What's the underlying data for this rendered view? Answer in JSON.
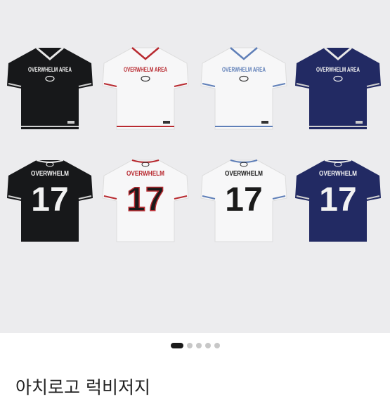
{
  "listing": {
    "title": "아치로고 럭비저지"
  },
  "gallery": {
    "image_count": 5,
    "active_index": 0
  },
  "jerseys": {
    "front_wordmark": "OVERWHELM AREA",
    "back_name": "OVERWHELM",
    "back_number": "17",
    "badge": "OW",
    "colors": {
      "black": "#17181a",
      "white": "#f7f7f8",
      "navy": "#222a63",
      "red_accent": "#b82a30",
      "blue_accent": "#5f7fb8"
    },
    "items": [
      {
        "name": "black-front"
      },
      {
        "name": "white-red-front"
      },
      {
        "name": "white-blue-front"
      },
      {
        "name": "navy-front"
      },
      {
        "name": "black-back"
      },
      {
        "name": "white-red-back"
      },
      {
        "name": "white-black-back"
      },
      {
        "name": "navy-back"
      }
    ]
  }
}
